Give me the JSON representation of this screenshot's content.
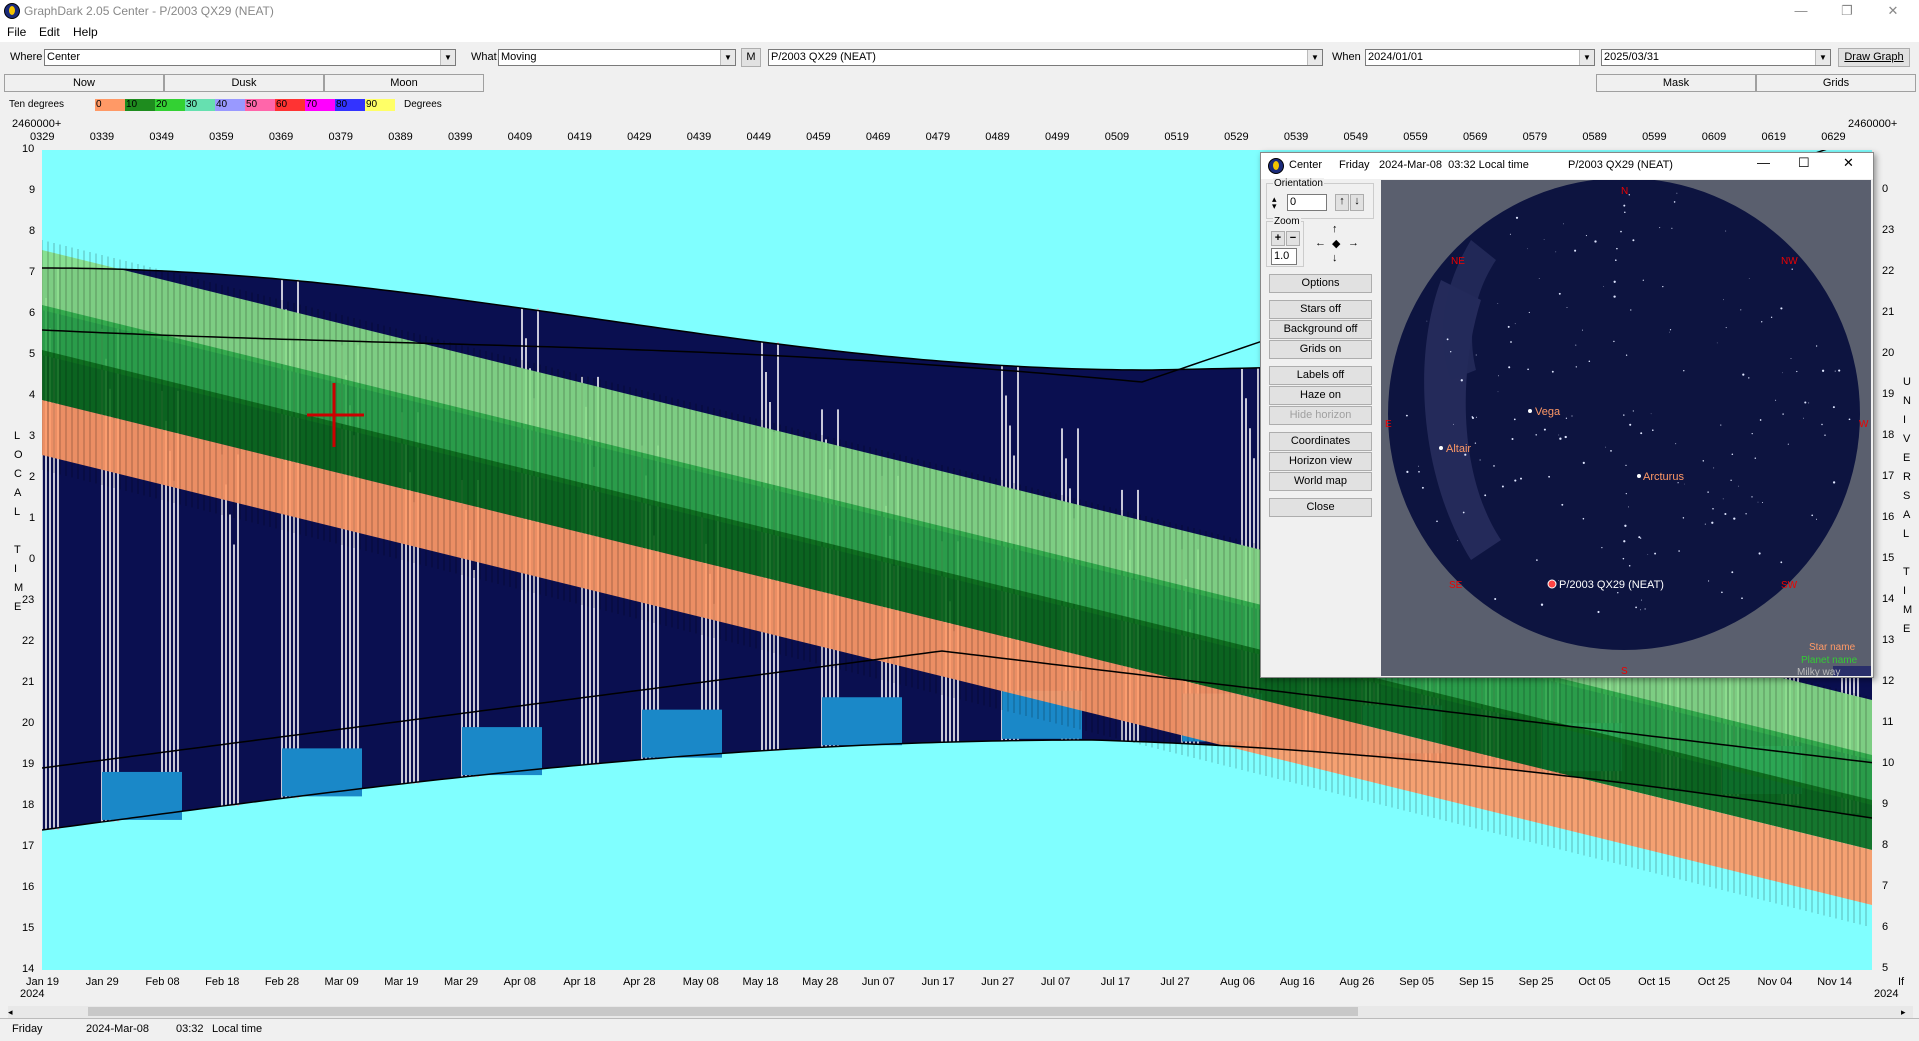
{
  "window": {
    "title": "GraphDark 2.05  Center  -  P/2003 QX29 (NEAT)",
    "minimize": "—",
    "maximize": "❐",
    "close": "✕"
  },
  "menu": [
    "File",
    "Edit",
    "Help"
  ],
  "toolbar": {
    "where_label": "Where",
    "where_value": "Center",
    "what_label": "What",
    "what_value": "Moving",
    "m_button": "M",
    "object_value": "P/2003 QX29 (NEAT)",
    "when_label": "When",
    "start_date": "2024/01/01",
    "end_date": "2025/03/31",
    "draw_button": "Draw Graph"
  },
  "tabs_left": [
    "Now",
    "Dusk",
    "Moon"
  ],
  "tabs_right": [
    "Mask",
    "Grids"
  ],
  "legend": {
    "label": "Ten degrees",
    "suffix": "Degrees",
    "segments": [
      {
        "text": "0",
        "color": "#ff9966"
      },
      {
        "text": "10",
        "color": "#1e8c1e"
      },
      {
        "text": "20",
        "color": "#33d133"
      },
      {
        "text": "30",
        "color": "#66e0b0"
      },
      {
        "text": "40",
        "color": "#9999ff"
      },
      {
        "text": "50",
        "color": "#ff66aa"
      },
      {
        "text": "60",
        "color": "#ff3333"
      },
      {
        "text": "70",
        "color": "#ff00ff"
      },
      {
        "text": "80",
        "color": "#3333ff"
      },
      {
        "text": "90",
        "color": "#ffff66"
      }
    ]
  },
  "top_axis": {
    "left_label": "2460000+",
    "right_label": "2460000+",
    "ticks": [
      "0329",
      "0339",
      "0349",
      "0359",
      "0369",
      "0379",
      "0389",
      "0399",
      "0409",
      "0419",
      "0429",
      "0439",
      "0449",
      "0459",
      "0469",
      "0479",
      "0489",
      "0499",
      "0509",
      "0519",
      "0529",
      "0539",
      "0549",
      "0559",
      "0569",
      "0579",
      "0589",
      "0599",
      "0609",
      "0619",
      "0629"
    ]
  },
  "left_axis": {
    "ticks": [
      "10",
      "9",
      "8",
      "7",
      "6",
      "5",
      "4",
      "3",
      "2",
      "1",
      "0",
      "23",
      "22",
      "21",
      "20",
      "19",
      "18",
      "17",
      "16",
      "15",
      "14"
    ],
    "title": [
      "L",
      "O",
      "C",
      "A",
      "L",
      "",
      "T",
      "I",
      "M",
      "E"
    ]
  },
  "right_axis": {
    "ticks": [
      "0",
      "23",
      "22",
      "21",
      "20",
      "19",
      "18",
      "17",
      "16",
      "15",
      "14",
      "13",
      "12",
      "11",
      "10",
      "9",
      "8",
      "7",
      "6",
      "5"
    ],
    "title": [
      "U",
      "N",
      "I",
      "V",
      "E",
      "R",
      "S",
      "A",
      "L",
      "",
      "T",
      "I",
      "M",
      "E"
    ]
  },
  "bottom_axis": {
    "ticks": [
      "Jan 19",
      "Jan 29",
      "Feb 08",
      "Feb 18",
      "Feb 28",
      "Mar 09",
      "Mar 19",
      "Mar 29",
      "Apr 08",
      "Apr 18",
      "Apr 28",
      "May 08",
      "May 18",
      "May 28",
      "Jun 07",
      "Jun 17",
      "Jun 27",
      "Jul 07",
      "Jul 17",
      "Jul 27",
      "Aug 06",
      "Aug 16",
      "Aug 26",
      "Sep 05",
      "Sep 15",
      "Sep 25",
      "Oct 05",
      "Oct 15",
      "Oct 25",
      "Nov 04",
      "Nov 14"
    ],
    "year_left": "2024",
    "year_right": "2024",
    "right_edge": "If"
  },
  "status": {
    "day": "Friday",
    "date": "2024-Mar-08",
    "time": "03:32",
    "zone": "Local time"
  },
  "sky": {
    "caption": {
      "place": "Center",
      "day": "Friday",
      "datetime": "2024-Mar-08  03:32 Local time",
      "object": "P/2003 QX29 (NEAT)"
    },
    "orientation_label": "Orientation",
    "orientation_value": "0",
    "zoom_label": "Zoom",
    "zoom_value": "1.0",
    "buttons": [
      "Options",
      "Stars off",
      "Background off",
      "Grids on",
      "Labels off",
      "Haze on",
      "Hide horizon",
      "Coordinates",
      "Horizon view",
      "World map",
      "Close"
    ],
    "compass": {
      "n": "N",
      "ne": "NE",
      "nw": "NW",
      "e": "E",
      "w": "W",
      "se": "SE",
      "sw": "SW",
      "s": "S"
    },
    "stars": {
      "vega": "Vega",
      "altair": "Altair",
      "arcturus": "Arcturus"
    },
    "target": "P/2003 QX29 (NEAT)",
    "legend": {
      "star_name": "Star name",
      "planet_name": "Planet name",
      "milky_way": "Milky way"
    }
  },
  "colors": {
    "sky_bg": "#80ffff",
    "night": "#0a0f50",
    "twilight_grey": "#c8c8d8",
    "moon_blue": "#1a88c8",
    "green_dark": "#0c6a1c",
    "green_mid": "#2ea84a",
    "green_light": "#88dd88",
    "orange": "#ff9966"
  }
}
